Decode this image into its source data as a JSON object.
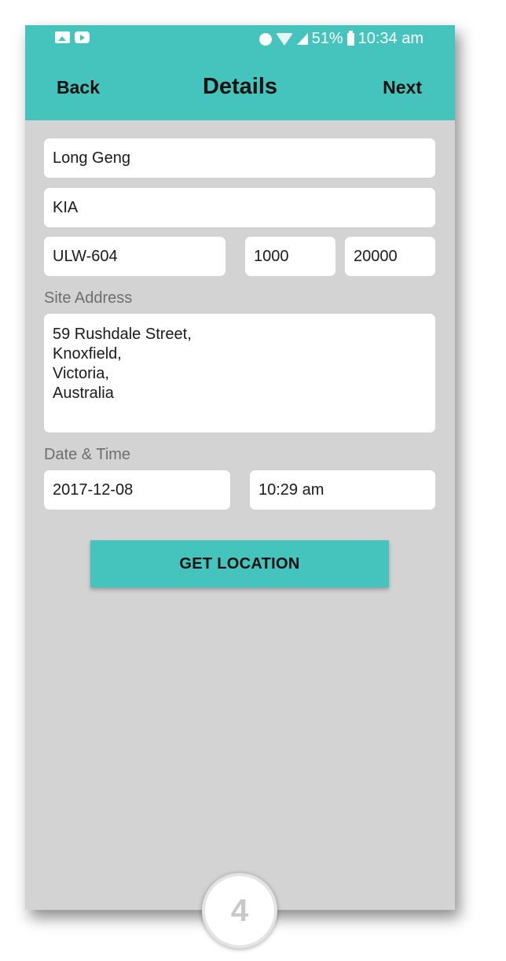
{
  "status_bar": {
    "battery": "51%",
    "time": "10:34 am",
    "icons": [
      "image-icon",
      "youtube-icon",
      "alarm-icon",
      "wifi-icon",
      "signal-icon",
      "battery-icon"
    ]
  },
  "header": {
    "back_label": "Back",
    "title": "Details",
    "next_label": "Next"
  },
  "form": {
    "name": "Long Geng",
    "company": "KIA",
    "plate": "ULW-604",
    "value_a": "1000",
    "value_b": "20000",
    "site_address_label": "Site Address",
    "address_lines": [
      "59 Rushdale Street,",
      "Knoxfield,",
      "Victoria,",
      "Australia"
    ],
    "date_time_label": "Date & Time",
    "date": "2017-12-08",
    "time": "10:29 am",
    "get_location_label": "GET LOCATION"
  },
  "step_badge": "4",
  "colors": {
    "accent": "#45c4bd",
    "background": "#d3d3d3",
    "field": "#ffffff",
    "label_text": "#6e6e6e"
  }
}
